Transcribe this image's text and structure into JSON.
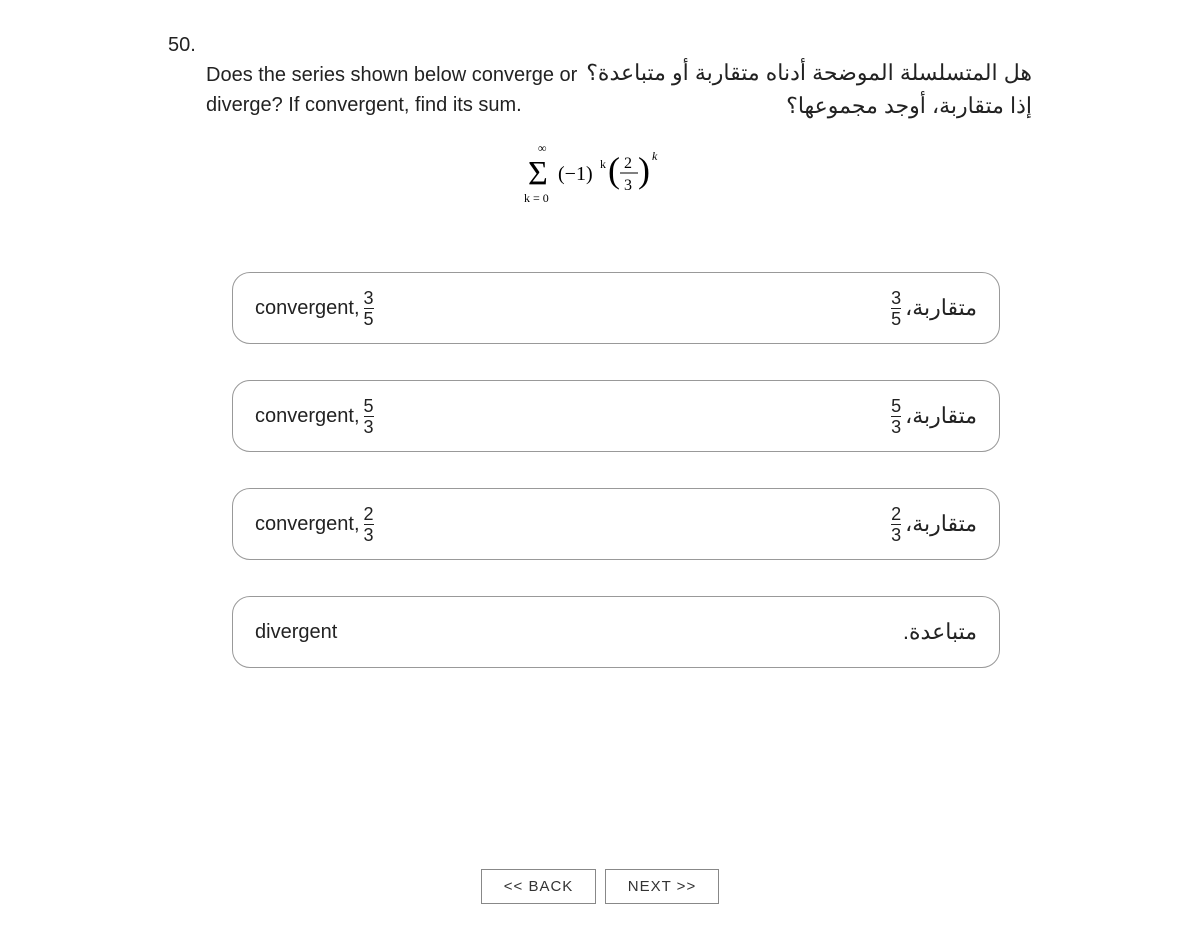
{
  "question": {
    "number": "50.",
    "english": "Does the series shown below converge or diverge?  If convergent, find its sum.",
    "arabic": "هل المتسلسلة الموضحة أدناه متقاربة أو متباعدة؟ إذا متقاربة، أوجد مجموعها؟"
  },
  "formula": {
    "latex": "\\sum_{k=0}^{\\infty} (-1)^k \\left(\\frac{2}{3}\\right)^k",
    "sum_lower": "k = 0",
    "sum_upper": "∞",
    "term": "(−1)",
    "exp1": "k",
    "frac_num": "2",
    "frac_den": "3",
    "exp2": "k"
  },
  "options": [
    {
      "en_label": "convergent,",
      "en_num": "3",
      "en_den": "5",
      "ar_label": "متقاربة،",
      "ar_num": "3",
      "ar_den": "5"
    },
    {
      "en_label": "convergent,",
      "en_num": "5",
      "en_den": "3",
      "ar_label": "متقاربة،",
      "ar_num": "5",
      "ar_den": "3"
    },
    {
      "en_label": "convergent,",
      "en_num": "2",
      "en_den": "3",
      "ar_label": "متقاربة،",
      "ar_num": "2",
      "ar_den": "3"
    },
    {
      "en_label": "divergent",
      "en_num": "",
      "en_den": "",
      "ar_label": "متباعدة.",
      "ar_num": "",
      "ar_den": ""
    }
  ],
  "nav": {
    "back": "<< BACK",
    "next": "NEXT >>"
  }
}
